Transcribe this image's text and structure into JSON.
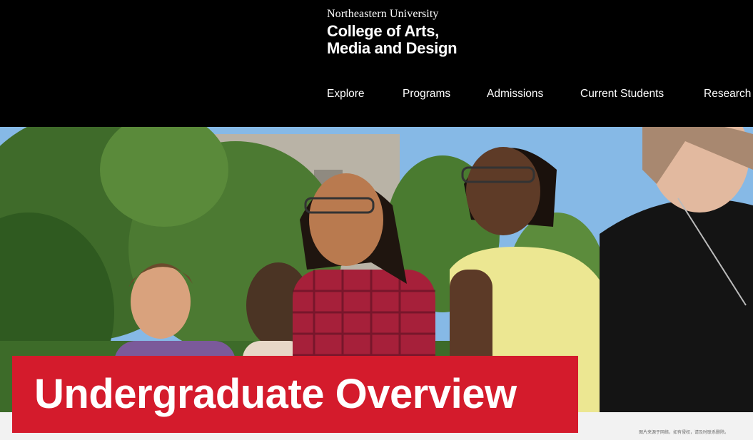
{
  "header": {
    "university_name": "Northeastern University",
    "college_line1": "College of Arts,",
    "college_line2": "Media and Design"
  },
  "nav": {
    "items": [
      {
        "label": "Explore"
      },
      {
        "label": "Programs"
      },
      {
        "label": "Admissions"
      },
      {
        "label": "Current Students"
      },
      {
        "label": "Research"
      }
    ]
  },
  "hero": {
    "title": "Undergraduate Overview"
  },
  "watermark": "图片来源于网络，如有侵权，请及时联系删除。",
  "colors": {
    "header_bg": "#000000",
    "accent_red": "#d41b2c",
    "text_white": "#ffffff"
  }
}
